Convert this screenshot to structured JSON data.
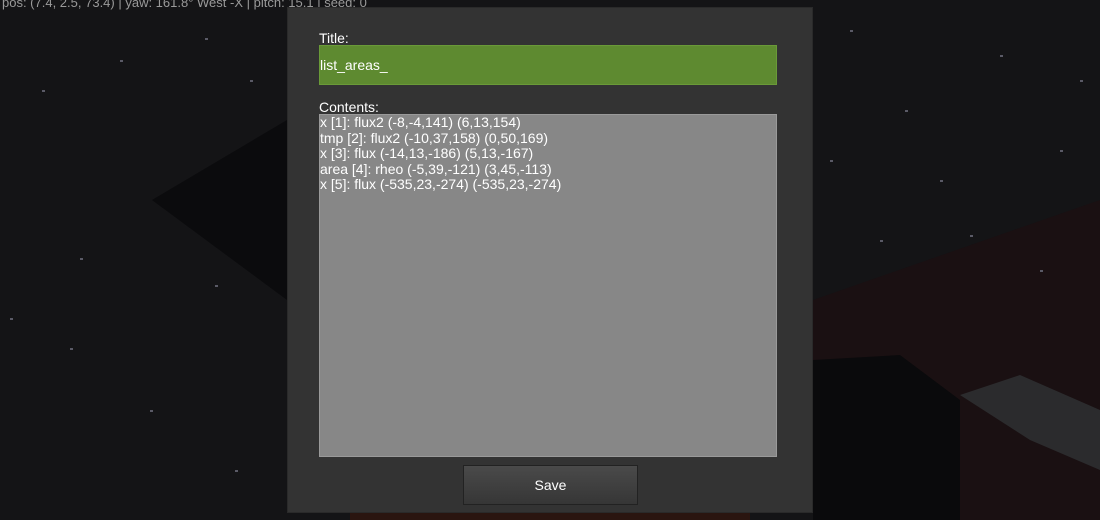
{
  "hud": {
    "position_text": "pos: (7.4, 2.5, 73.4) | yaw: 161.8° West -X | pitch: 15.1 | seed: 0"
  },
  "dialog": {
    "title_label": "Title:",
    "title_value": "list_areas_",
    "contents_label": "Contents:",
    "contents_lines": [
      "x [1]: flux2 (-8,-4,141) (6,13,154)",
      "tmp [2]: flux2 (-10,37,158) (0,50,169)",
      "x [3]: flux (-14,13,-186) (5,13,-167)",
      "area [4]: rheo (-5,39,-121) (3,45,-113)",
      "x [5]: flux (-535,23,-274) (-535,23,-274)"
    ],
    "save_label": "Save"
  },
  "colors": {
    "title_field_bg": "#5e8a30",
    "contents_bg": "#878787",
    "dialog_bg": "#333333"
  }
}
